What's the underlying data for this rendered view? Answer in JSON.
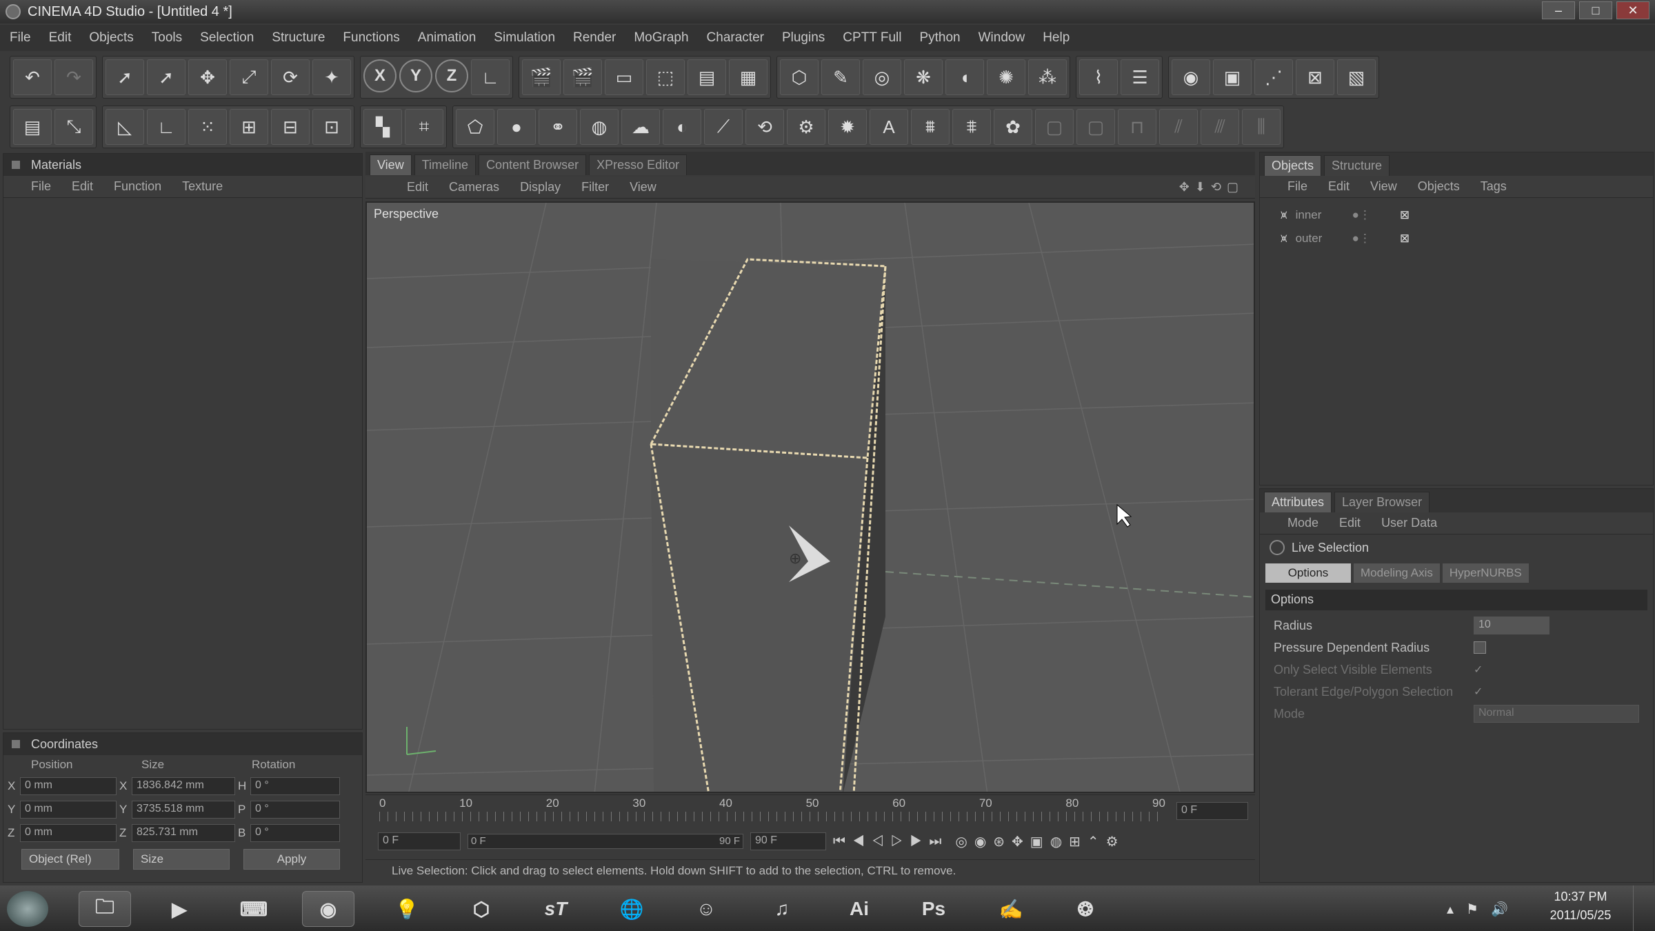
{
  "window": {
    "title": "CINEMA 4D Studio - [Untitled 4 *]",
    "controls": [
      "–",
      "□",
      "✕"
    ]
  },
  "menu": [
    "File",
    "Edit",
    "Objects",
    "Tools",
    "Selection",
    "Structure",
    "Functions",
    "Animation",
    "Simulation",
    "Render",
    "MoGraph",
    "Character",
    "Plugins",
    "CPTT Full",
    "Python",
    "Window",
    "Help"
  ],
  "toolbar1": {
    "axis_buttons": [
      "X",
      "Y",
      "Z"
    ]
  },
  "materials": {
    "title": "Materials",
    "menu": [
      "File",
      "Edit",
      "Function",
      "Texture"
    ]
  },
  "coordinates": {
    "title": "Coordinates",
    "headers": [
      "Position",
      "Size",
      "Rotation"
    ],
    "rows": [
      {
        "axis": "X",
        "pos": "0 mm",
        "size_axis": "X",
        "size": "1836.842 mm",
        "rot_axis": "H",
        "rot": "0 °"
      },
      {
        "axis": "Y",
        "pos": "0 mm",
        "size_axis": "Y",
        "size": "3735.518 mm",
        "rot_axis": "P",
        "rot": "0 °"
      },
      {
        "axis": "Z",
        "pos": "0 mm",
        "size_axis": "Z",
        "size": "825.731 mm",
        "rot_axis": "B",
        "rot": "0 °"
      }
    ],
    "mode_select": "Object (Rel)",
    "size_select": "Size",
    "apply_label": "Apply"
  },
  "view_tabs": [
    "View",
    "Timeline",
    "Content Browser",
    "XPresso Editor"
  ],
  "viewport": {
    "menu": [
      "Edit",
      "Cameras",
      "Display",
      "Filter",
      "View"
    ],
    "label": "Perspective"
  },
  "timeline": {
    "ticks": [
      "0",
      "10",
      "20",
      "30",
      "40",
      "50",
      "60",
      "70",
      "80",
      "90"
    ],
    "end_frame": "0 F",
    "start_field": "0 F",
    "slider_start": "0 F",
    "slider_end": "90 F",
    "max_field": "90 F"
  },
  "statusbar": {
    "text": "Live Selection: Click and drag to select elements. Hold down SHIFT to add to the selection, CTRL to remove."
  },
  "objects": {
    "tabs": [
      "Objects",
      "Structure"
    ],
    "menu": [
      "File",
      "Edit",
      "View",
      "Objects",
      "Tags"
    ],
    "items": [
      "inner",
      "outer"
    ]
  },
  "attributes": {
    "tabs": [
      "Attributes",
      "Layer Browser"
    ],
    "menu": [
      "Mode",
      "Edit",
      "User Data"
    ],
    "tool_name": "Live Selection",
    "subtabs": [
      "Options",
      "Modeling Axis",
      "HyperNURBS"
    ],
    "section": "Options",
    "fields": [
      {
        "label": "Radius",
        "value": "10",
        "dim": false
      },
      {
        "label": "Pressure Dependent Radius",
        "value": "",
        "dim": false
      },
      {
        "label": "Only Select Visible Elements",
        "value": "✓",
        "dim": true
      },
      {
        "label": "Tolerant Edge/Polygon Selection",
        "value": "✓",
        "dim": true
      },
      {
        "label": "Mode",
        "value": "Normal",
        "dim": true
      }
    ]
  },
  "taskbar": {
    "icons": [
      "start-orb",
      "file-explorer",
      "media-player",
      "terminal",
      "cinema4d",
      "lightbulb",
      "unity",
      "sT",
      "world",
      "chat",
      "itunes",
      "Ai",
      "Ps",
      "stamp",
      "3d-app"
    ],
    "ai_label": "Ai",
    "ps_label": "Ps",
    "st_label": "sT",
    "time": "10:37 PM",
    "date": "2011/05/25"
  },
  "colors": {
    "viewport_bg": "#585858",
    "panel_bg": "#3a3a3a",
    "selection_edge": "#e8d9b0"
  }
}
